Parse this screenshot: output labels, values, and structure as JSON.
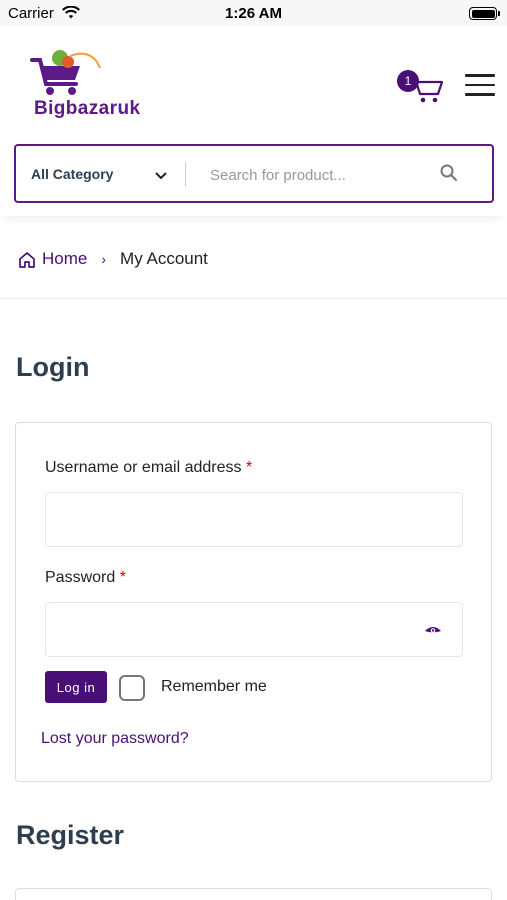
{
  "status_bar": {
    "carrier": "Carrier",
    "time": "1:26 AM"
  },
  "header": {
    "brand": "Bigbazaruk",
    "cart_count": "1",
    "category_label": "All Category",
    "search_placeholder": "Search for product...",
    "brand_color": "#5b1a85"
  },
  "breadcrumb": {
    "home": "Home",
    "separator": "›",
    "current": "My Account"
  },
  "login": {
    "title": "Login",
    "username_label": "Username or email address",
    "password_label": "Password",
    "required_mark": "*",
    "login_button": "Log in",
    "remember_me": "Remember me",
    "lost_password": "Lost your password?"
  },
  "register": {
    "title": "Register"
  },
  "icons": [
    "wifi-icon",
    "battery-icon",
    "cart-icon",
    "menu-icon",
    "chevron-down-icon",
    "search-icon",
    "home-icon",
    "eye-icon"
  ]
}
